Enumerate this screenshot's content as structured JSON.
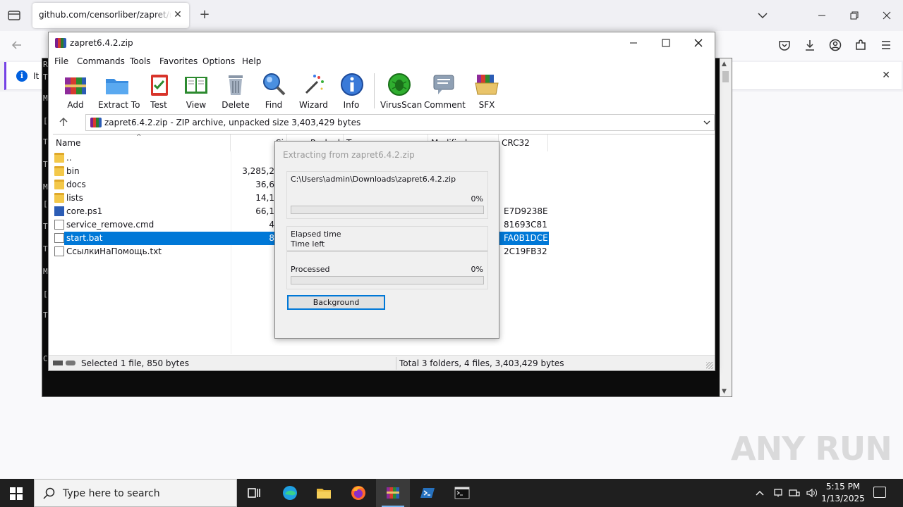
{
  "browser": {
    "tab_title": "github.com/censorliber/zapret/rele",
    "tab_close": "✕",
    "new_tab": "+",
    "info_text": "It l"
  },
  "console": {
    "left_chars": [
      "R",
      "T",
      "M",
      "[",
      "T",
      "T",
      "M",
      "[",
      "T",
      "T",
      "M",
      "[",
      "T",
      "C"
    ]
  },
  "rar": {
    "title": "zapret6.4.2.zip",
    "menu": [
      "File",
      "Commands",
      "Tools",
      "Favorites",
      "Options",
      "Help"
    ],
    "toolbar": [
      {
        "label": "Add",
        "icon": "add-archive-icon"
      },
      {
        "label": "Extract To",
        "icon": "extract-folder-icon"
      },
      {
        "label": "Test",
        "icon": "test-clipboard-icon"
      },
      {
        "label": "View",
        "icon": "view-book-icon"
      },
      {
        "label": "Delete",
        "icon": "trash-icon"
      },
      {
        "label": "Find",
        "icon": "magnifier-icon"
      },
      {
        "label": "Wizard",
        "icon": "magic-wand-icon"
      },
      {
        "label": "Info",
        "icon": "info-icon"
      },
      {
        "label": "VirusScan",
        "icon": "virus-scan-icon"
      },
      {
        "label": "Comment",
        "icon": "comment-icon"
      },
      {
        "label": "SFX",
        "icon": "sfx-box-icon"
      }
    ],
    "address": "zapret6.4.2.zip - ZIP archive, unpacked size 3,403,429 bytes",
    "columns": {
      "name": "Name",
      "size": "Si",
      "packed": "Packed",
      "type": "T",
      "modified": "Modified",
      "crc": "CRC32"
    },
    "files": [
      {
        "name": "..",
        "size": "",
        "crc": "",
        "kind": "folder"
      },
      {
        "name": "bin",
        "size": "3,285,2",
        "crc": "",
        "kind": "folder"
      },
      {
        "name": "docs",
        "size": "36,6",
        "crc": "",
        "kind": "folder"
      },
      {
        "name": "lists",
        "size": "14,1",
        "crc": "",
        "kind": "folder"
      },
      {
        "name": "core.ps1",
        "size": "66,1",
        "crc": "E7D9238E",
        "kind": "ps"
      },
      {
        "name": "service_remove.cmd",
        "size": "4",
        "crc": "81693C81",
        "kind": "cmd"
      },
      {
        "name": "start.bat",
        "size": "8",
        "crc": "FA0B1DCE",
        "kind": "cmd",
        "selected": true
      },
      {
        "name": "СсылкиНаПомощь.txt",
        "size": "",
        "crc": "2C19FB32",
        "kind": "txt"
      }
    ],
    "status_left": "Selected 1 file, 850 bytes",
    "status_right": "Total 3 folders, 4 files, 3,403,429 bytes"
  },
  "dialog": {
    "title": "Extracting from zapret6.4.2.zip",
    "path": "C:\\Users\\admin\\Downloads\\zapret6.4.2.zip",
    "file_progress_pct": "0%",
    "file_progress": 0,
    "elapsed_label": "Elapsed time",
    "time_left_label": "Time left",
    "processed_label": "Processed",
    "processed_pct": "0%",
    "processed_progress": 0,
    "background_button": "Background"
  },
  "watermark": "ANY RUN",
  "taskbar": {
    "search_placeholder": "Type here to search",
    "time": "5:15 PM",
    "date": "1/13/2025",
    "apps": [
      "task-view-icon",
      "edge-icon",
      "file-explorer-icon",
      "firefox-icon",
      "winrar-icon",
      "powershell-icon",
      "terminal-icon"
    ]
  },
  "colors": {
    "selection": "#0078d7",
    "taskbar": "#1f1f1f",
    "accent_purple": "#7542e5"
  }
}
